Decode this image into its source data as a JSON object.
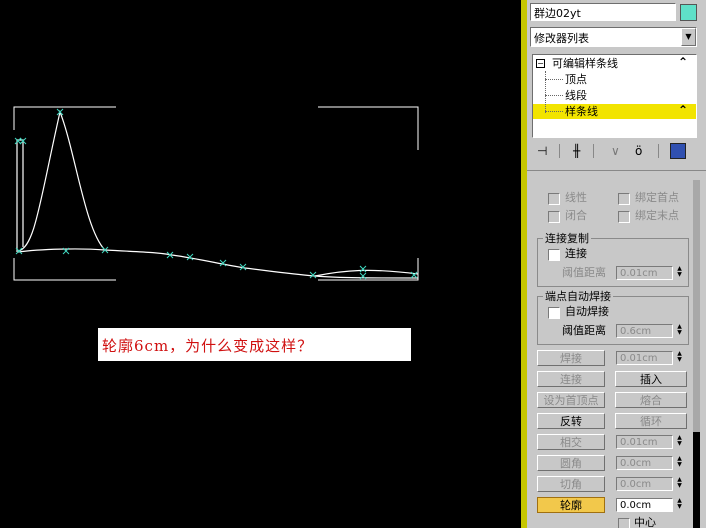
{
  "object_name": "群边02yt",
  "object_color": "#5fe0c8",
  "modifier_list": "修改器列表",
  "stack": {
    "root": "可编辑样条线",
    "items": [
      "顶点",
      "线段",
      "样条线"
    ],
    "selected_index": 2
  },
  "caption": "轮廓6cm，为什么变成这样？",
  "caption_color": "#d01010",
  "highlight_color": "#f2e400",
  "spline_color": "#ffffff",
  "vertex_color": "#40d8c0",
  "rollout": {
    "linear": "线性",
    "closed": "闭合",
    "bind_first": "绑定首点",
    "bind_last": "绑定末点",
    "connect_copy_title": "连接复制",
    "connect_label": "连接",
    "threshold_label": "阈值距离",
    "threshold_value1": "0.01cm",
    "endpoint_weld_title": "端点自动焊接",
    "auto_weld_label": "自动焊接",
    "threshold_value2": "0.6cm",
    "weld_btn": "焊接",
    "weld_value": "0.01cm",
    "connect_btn": "连接",
    "insert_btn": "插入",
    "make_first_btn": "设为首顶点",
    "fuse_btn": "熔合",
    "reverse_btn": "反转",
    "cycle_btn": "循环",
    "intersect_btn": "相交",
    "intersect_value": "0.01cm",
    "fillet_btn": "圆角",
    "fillet_value": "0.0cm",
    "chamfer_btn": "切角",
    "chamfer_value": "0.0cm",
    "outline_btn": "轮廓",
    "outline_value": "0.0cm",
    "center_label": "中心"
  }
}
